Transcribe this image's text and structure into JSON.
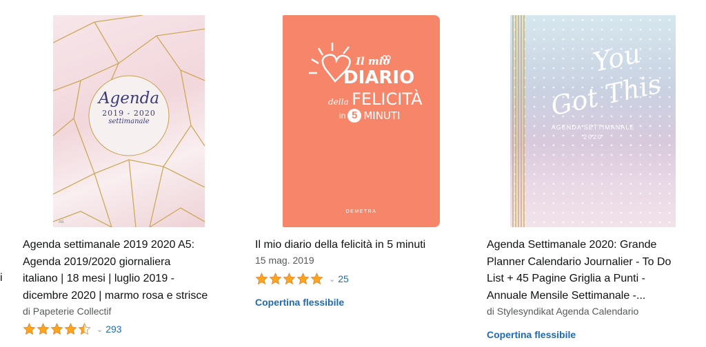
{
  "left_fragment": "i",
  "products": [
    {
      "cover": {
        "title": "Agenda",
        "years": "2019 - 2020",
        "subtitle": "settimanale",
        "size_mark": "A5",
        "colors": {
          "bg": "#f3dce0",
          "gold": "#c9a24a"
        }
      },
      "title_lines": [
        "Agenda settimanale 2019 2020 A5:",
        "Agenda 2019/2020 giornaliera",
        "italiano | 18 mesi | luglio 2019 -",
        "dicembre 2020 | marmo rosa e strisce"
      ],
      "byline": "di Papeterie Collectif",
      "rating": 4.5,
      "rating_count": "293"
    },
    {
      "cover": {
        "line1": "Il mio",
        "line2": "DIARIO",
        "line3a": "della",
        "line3b": "FELICITÀ",
        "line4a": "in",
        "line4b": "5",
        "line4c": "MINUTI",
        "publisher": "DEMETRA",
        "colors": {
          "bg": "#f7856a"
        }
      },
      "title_lines": [
        "Il mio diario della felicità in 5 minuti"
      ],
      "date": "15 mag. 2019",
      "rating": 5,
      "rating_count": "25",
      "format": "Copertina flessibile"
    },
    {
      "cover": {
        "script1": "You",
        "script2": "Got This",
        "subtitle": "AGENDA SETTIMANALE",
        "year": "2020",
        "colors": {
          "gold": "#c9a24a"
        }
      },
      "title_lines": [
        "Agenda Settimanale 2020: Grande",
        "Planner Calendario Journalier - To Do",
        "List + 45 Pagine Griglia a Punti -",
        "Annuale Mensile Settimanale -..."
      ],
      "byline": "di Stylesyndikat Agenda Calendario",
      "format": "Copertina flessibile"
    }
  ],
  "colors": {
    "link": "#1f6ab4",
    "star": "#ffa41c",
    "text": "#0f1111",
    "muted": "#565959"
  }
}
